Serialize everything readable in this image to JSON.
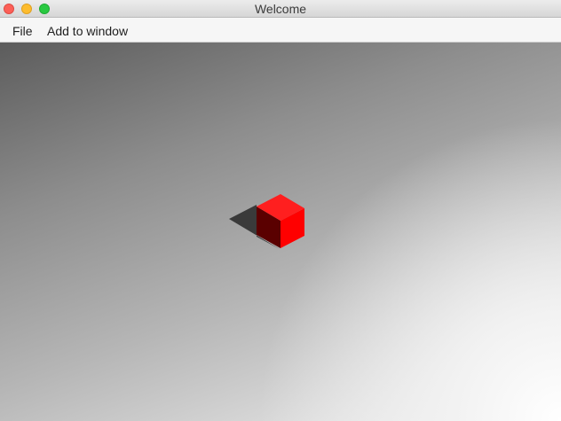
{
  "window": {
    "title": "Welcome"
  },
  "menu": {
    "items": [
      "File",
      "Add to window"
    ]
  },
  "scene": {
    "object": "cube",
    "colors": {
      "cube_top": "#ff1f1f",
      "cube_right": "#ff0000",
      "cube_left": "#5a0000",
      "shadow": "#3a3a3a"
    }
  }
}
